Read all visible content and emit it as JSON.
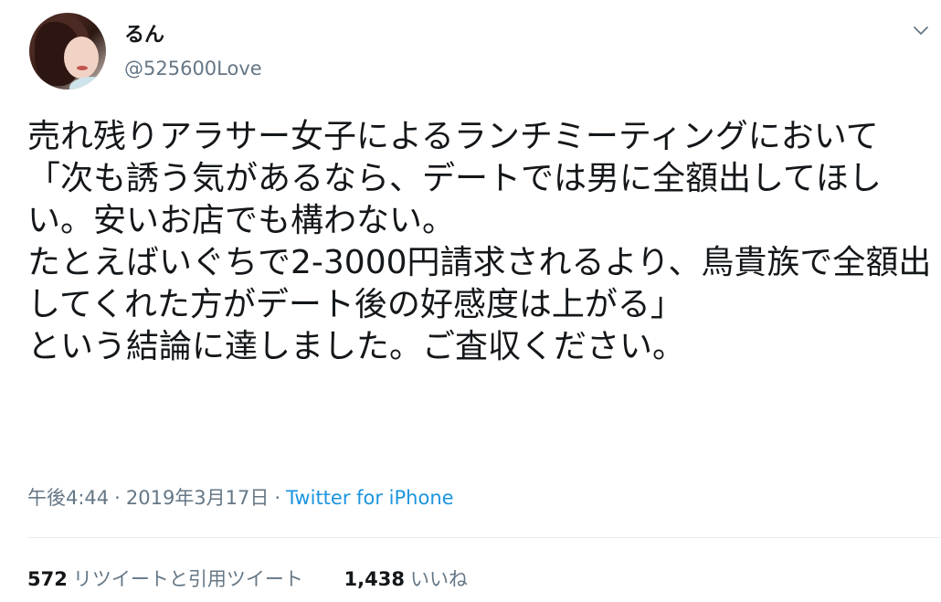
{
  "user": {
    "display_name": "るん",
    "handle": "@525600Love"
  },
  "tweet": {
    "text": "売れ残りアラサー女子によるランチミーティングにおいて\n「次も誘う気があるなら、デートでは男に全額出してほしい。安いお店でも構わない。\nたとえばいぐちで2-3000円請求されるより、鳥貴族で全額出してくれた方がデート後の好感度は上がる」\nという結論に達しました。ご査収ください。",
    "time": "午後4:44",
    "date": "2019年3月17日",
    "separator": "·",
    "source": "Twitter for iPhone"
  },
  "stats": {
    "retweets_count": "572",
    "retweets_label": "リツイートと引用ツイート",
    "likes_count": "1,438",
    "likes_label": "いいね"
  },
  "icons": {
    "caret": "chevron-down-icon",
    "avatar": "avatar"
  }
}
